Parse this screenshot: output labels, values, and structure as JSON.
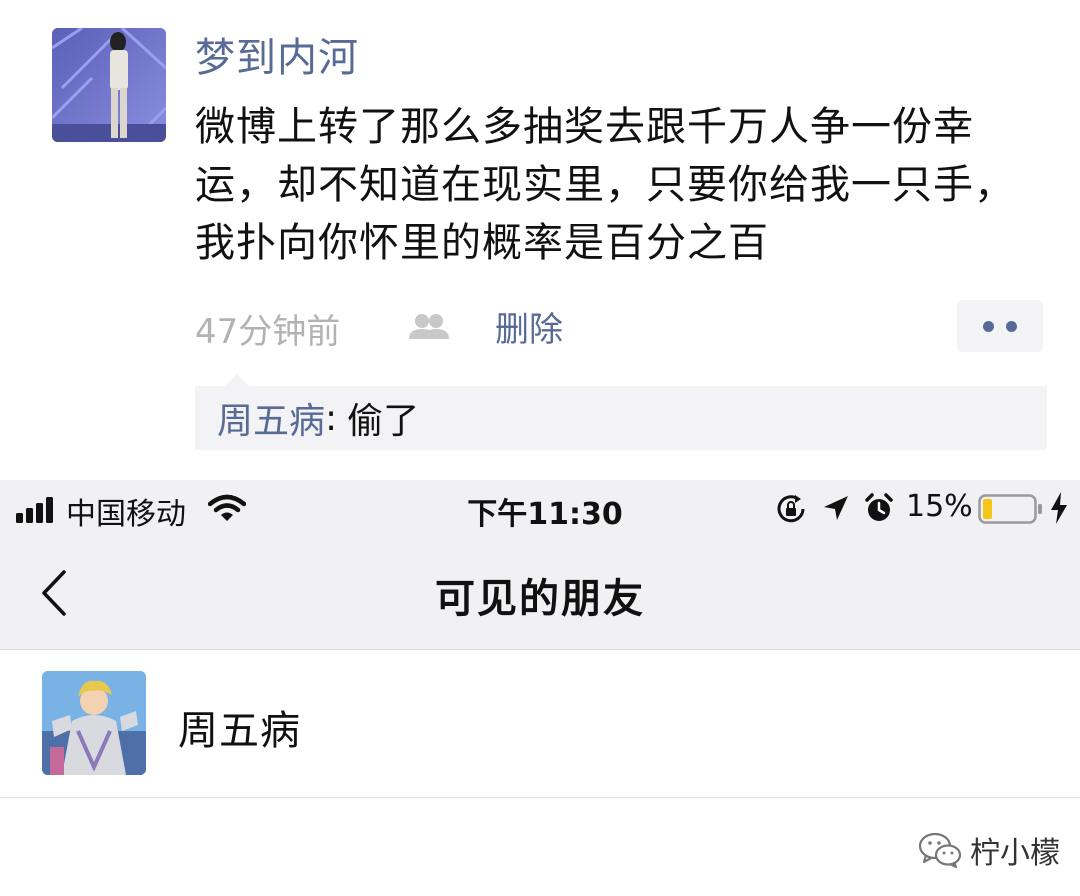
{
  "post": {
    "author": "梦到内河",
    "text": "微博上转了那么多抽奖去跟千万人争一份幸运，却不知道在现实里，只要你给我一只手，我扑向你怀里的概率是百分之百",
    "time": "47分钟前",
    "delete_label": "删除",
    "comment": {
      "author": "周五病",
      "colon": ":",
      "text": "偷了"
    },
    "link_color": "#576b95"
  },
  "status_bar": {
    "carrier": "中国移动",
    "time": "下午11:30",
    "battery": "15%",
    "battery_color": "#f5c518"
  },
  "nav": {
    "title": "可见的朋友"
  },
  "friends": [
    {
      "name": "周五病"
    }
  ],
  "watermark": {
    "text": "柠小檬"
  },
  "icons": {
    "post_avatar": "person-photo-avatar",
    "friends_visibility": "two-people-icon",
    "more": "two-dots-icon",
    "signal": "signal-bars-icon",
    "wifi": "wifi-icon",
    "rotation_lock": "rotation-lock-icon",
    "location": "location-arrow-icon",
    "alarm": "alarm-clock-icon",
    "battery": "battery-icon",
    "charging": "charging-bolt-icon",
    "back": "chevron-left-icon",
    "friend_avatar": "anime-character-avatar",
    "wechat": "wechat-logo-icon"
  }
}
